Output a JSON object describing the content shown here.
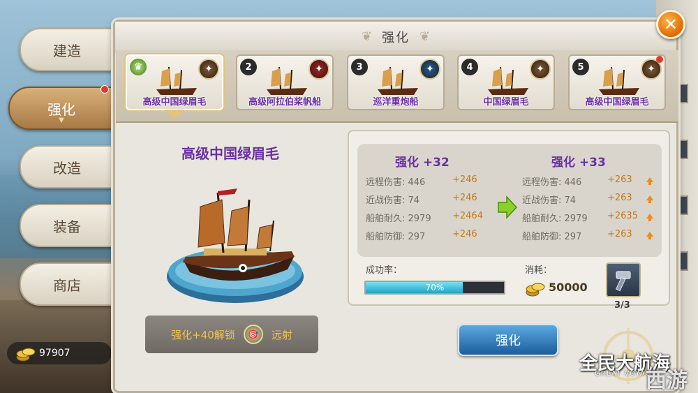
{
  "sidebar": {
    "tabs": [
      {
        "label": "建造"
      },
      {
        "label": "强化"
      },
      {
        "label": "改造"
      },
      {
        "label": "装备"
      },
      {
        "label": "商店"
      }
    ],
    "active_index": 1
  },
  "currency": {
    "value": "97907"
  },
  "panel": {
    "title": "强化",
    "close_label": "✕"
  },
  "ships": [
    {
      "num": "",
      "name": "高级中国绿眉毛",
      "skill_color": "#6b4a2a",
      "selected": true,
      "alert": false
    },
    {
      "num": "2",
      "name": "高级阿拉伯桨帆船",
      "skill_color": "#8a1e1e",
      "selected": false,
      "alert": false
    },
    {
      "num": "3",
      "name": "巡洋重炮船",
      "skill_color": "#1d4e7a",
      "selected": false,
      "alert": false
    },
    {
      "num": "4",
      "name": "中国绿眉毛",
      "skill_color": "#6b4a2a",
      "selected": false,
      "alert": false
    },
    {
      "num": "5",
      "name": "高级中国绿眉毛",
      "skill_color": "#6b4a2a",
      "selected": false,
      "alert": true
    }
  ],
  "detail": {
    "ship_name": "高级中国绿眉毛",
    "unlock_text": "强化+40解锁",
    "unlock_skill": "远射"
  },
  "stats": {
    "current": {
      "title": "强化 +32",
      "rows": [
        {
          "label": "远程伤害: 446",
          "add": "+246"
        },
        {
          "label": "近战伤害: 74",
          "add": "+246"
        },
        {
          "label": "船舶耐久: 2979",
          "add": "+2464"
        },
        {
          "label": "船舶防御: 297",
          "add": "+246"
        }
      ]
    },
    "next": {
      "title": "强化 +33",
      "rows": [
        {
          "label": "远程伤害: 446",
          "add": "+263"
        },
        {
          "label": "近战伤害: 74",
          "add": "+263"
        },
        {
          "label": "船舶耐久: 2979",
          "add": "+2635"
        },
        {
          "label": "船舶防御: 297",
          "add": "+263"
        }
      ]
    }
  },
  "success": {
    "label": "成功率：",
    "value_text": "70%",
    "fraction": 0.7
  },
  "cost": {
    "label": "消耗：",
    "value": "50000"
  },
  "hammer": {
    "count": "3/3"
  },
  "enhance_button": {
    "label": "强化"
  },
  "logo": {
    "cn": "全民大航海",
    "en": "GREAT VOYAGE",
    "watermark": "西游"
  },
  "colors": {
    "accent_purple": "#6a2fa6",
    "gain_orange": "#c27a14",
    "button_blue": "#1d5c9c"
  }
}
